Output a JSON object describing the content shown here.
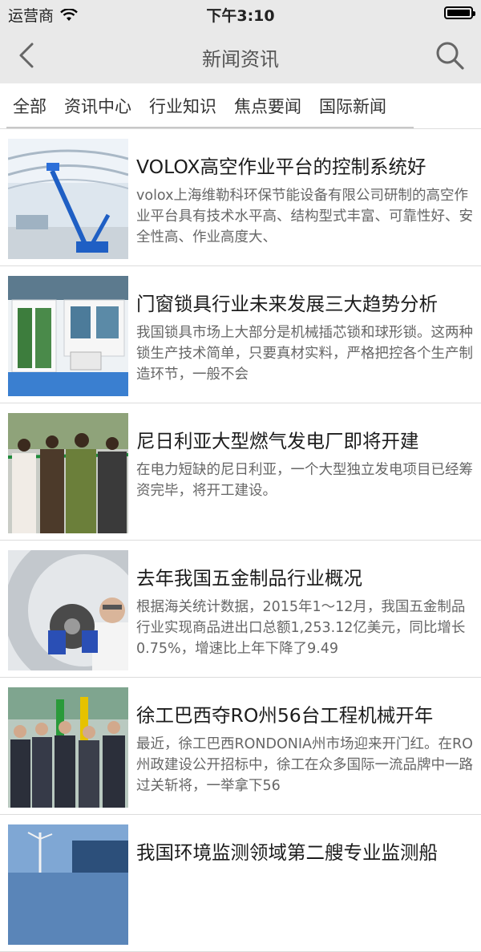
{
  "status_bar": {
    "carrier": "运营商",
    "time": "下午3:10"
  },
  "header": {
    "title": "新闻资讯"
  },
  "tabs": [
    {
      "label": "全部"
    },
    {
      "label": "资讯中心"
    },
    {
      "label": "行业知识"
    },
    {
      "label": "焦点要闻"
    },
    {
      "label": "国际新闻"
    }
  ],
  "news": [
    {
      "title": "VOLOX高空作业平台的控制系统好",
      "summary": "volox上海维勒科环保节能设备有限公司研制的高空作业平台具有技术水平高、结构型式丰富、可靠性好、安全性高、作业高度大、"
    },
    {
      "title": "门窗锁具行业未来发展三大趋势分析",
      "summary": "我国锁具市场上大部分是机械插芯锁和球形锁。这两种锁生产技术简单，只要真材实料，严格把控各个生产制造环节，一般不会"
    },
    {
      "title": "尼日利亚大型燃气发电厂即将开建",
      "summary": "在电力短缺的尼日利亚，一个大型独立发电项目已经筹资完毕，将开工建设。"
    },
    {
      "title": "去年我国五金制品行业概况",
      "summary": "根据海关统计数据，2015年1～12月，我国五金制品行业实现商品进出口总额1,253.12亿美元，同比增长0.75%，增速比上年下降了9.49"
    },
    {
      "title": "徐工巴西夺RO州56台工程机械开年",
      "summary": "最近，徐工巴西RONDONIA州市场迎来开门红。在RO州政建设公开招标中，徐工在众多国际一流品牌中一路过关斩将，一举拿下56"
    },
    {
      "title": "我国环境监测领域第二艘专业监测船",
      "summary": ""
    }
  ]
}
